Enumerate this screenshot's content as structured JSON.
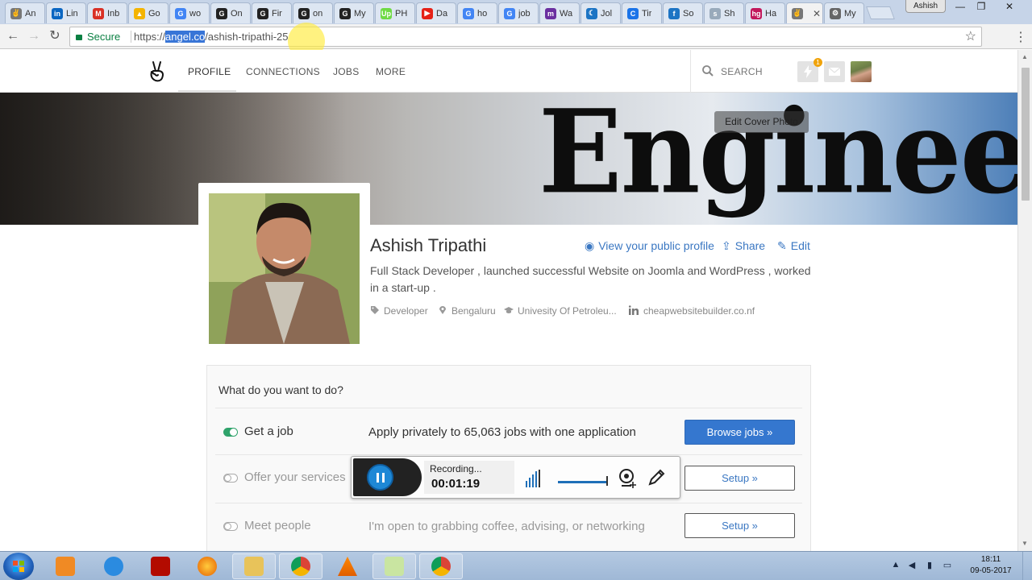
{
  "browser": {
    "tabs": [
      {
        "title": "An",
        "favicon_color": "#777777",
        "favicon_glyph": "✌"
      },
      {
        "title": "Lin",
        "favicon_color": "#0a66c2",
        "favicon_glyph": "in"
      },
      {
        "title": "Inb",
        "favicon_color": "#d93025",
        "favicon_glyph": "M"
      },
      {
        "title": "Go",
        "favicon_color": "#f4b400",
        "favicon_glyph": "▲"
      },
      {
        "title": "wo",
        "favicon_color": "#4285f4",
        "favicon_glyph": "G"
      },
      {
        "title": "On",
        "favicon_color": "#222222",
        "favicon_glyph": "G"
      },
      {
        "title": "Fir",
        "favicon_color": "#222222",
        "favicon_glyph": "G"
      },
      {
        "title": "on",
        "favicon_color": "#222222",
        "favicon_glyph": "G"
      },
      {
        "title": "My",
        "favicon_color": "#222222",
        "favicon_glyph": "G"
      },
      {
        "title": "PH",
        "favicon_color": "#6fda44",
        "favicon_glyph": "Up"
      },
      {
        "title": "Da",
        "favicon_color": "#e62117",
        "favicon_glyph": "▶"
      },
      {
        "title": "ho",
        "favicon_color": "#4285f4",
        "favicon_glyph": "G"
      },
      {
        "title": "job",
        "favicon_color": "#4285f4",
        "favicon_glyph": "G"
      },
      {
        "title": "Wa",
        "favicon_color": "#6b2fa0",
        "favicon_glyph": "m"
      },
      {
        "title": "Jol",
        "favicon_color": "#1c74c4",
        "favicon_glyph": "☾"
      },
      {
        "title": "Tir",
        "favicon_color": "#1a73e8",
        "favicon_glyph": "C"
      },
      {
        "title": "So",
        "favicon_color": "#1c74c4",
        "favicon_glyph": "f"
      },
      {
        "title": "Sh",
        "favicon_color": "#99aabb",
        "favicon_glyph": "s"
      },
      {
        "title": "Ha",
        "favicon_color": "#c2185b",
        "favicon_glyph": "hg"
      },
      {
        "title": "",
        "favicon_color": "#777777",
        "favicon_glyph": "✌",
        "active": true
      },
      {
        "title": "My",
        "favicon_color": "#666666",
        "favicon_glyph": "⚙"
      }
    ],
    "user_badge": "Ashish",
    "url_scheme": "https://",
    "url_domain": "angel.co",
    "url_path": "/ashish-tripathi-25",
    "secure_label": "Secure"
  },
  "site_nav": {
    "links": [
      "PROFILE",
      "CONNECTIONS",
      "JOBS",
      "MORE"
    ],
    "search_placeholder": "SEARCH",
    "notification_count": "1"
  },
  "cover": {
    "word": "Engineer",
    "edit_label": "Edit Cover Photo"
  },
  "profile": {
    "name": "Ashish Tripathi",
    "view_public": "View your public profile",
    "share": "Share",
    "edit": "Edit",
    "bio": "Full Stack Developer , launched successful Website on Joomla and WordPress , worked in a start-up .",
    "role": "Developer",
    "location": "Bengaluru",
    "education": "Univesity Of Petroleu...",
    "website": "cheapwebsitebuilder.co.nf"
  },
  "panel": {
    "title": "What do you want to do?",
    "rows": [
      {
        "label": "Get a job",
        "desc": "Apply privately to 65,063 jobs with one application",
        "button": "Browse jobs »",
        "on": true
      },
      {
        "label": "Offer your services",
        "desc": "",
        "button": "Setup »",
        "on": false
      },
      {
        "label": "Meet people",
        "desc": "I'm open to grabbing coffee, advising, or networking",
        "button": "Setup »",
        "on": false
      }
    ]
  },
  "recorder": {
    "status": "Recording...",
    "elapsed": "00:01:19"
  },
  "taskbar": {
    "time": "18:11",
    "date": "09-05-2017"
  },
  "colors": {
    "accent": "#3577cf",
    "toggle_on": "#2fa36b",
    "link": "#3a77c2"
  }
}
